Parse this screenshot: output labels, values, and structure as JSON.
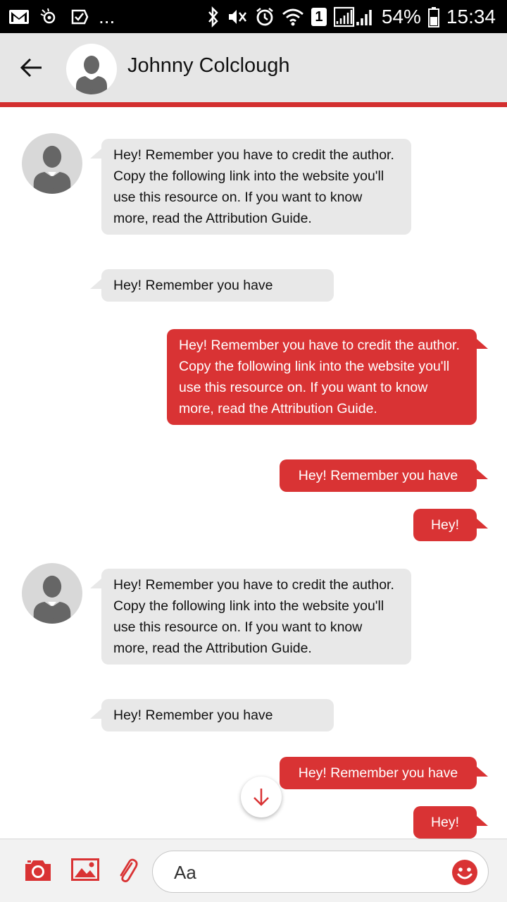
{
  "status_bar": {
    "battery": "54%",
    "time": "15:34",
    "sim_badge": "1",
    "more": "..."
  },
  "header": {
    "contact_name": "Johnny Colclough"
  },
  "messages": [
    {
      "direction": "in",
      "text": "Hey! Remember you have to credit the author. Copy the following link into the website you'll use this resource on. If you want to know more, read the Attribution Guide."
    },
    {
      "direction": "in",
      "text": "Hey! Remember you have"
    },
    {
      "direction": "out",
      "text": "Hey! Remember you have to credit the author. Copy the following link into the website you'll use this resource on. If you want to know more, read the Attribution Guide."
    },
    {
      "direction": "out",
      "text": "Hey! Remember you have"
    },
    {
      "direction": "out",
      "text": "Hey!"
    },
    {
      "direction": "in",
      "text": "Hey! Remember you have to credit the author. Copy the following link into the website you'll use this resource on. If you want to know more, read the Attribution Guide."
    },
    {
      "direction": "in",
      "text": "Hey! Remember you have"
    },
    {
      "direction": "out",
      "text": "Hey! Remember you have"
    },
    {
      "direction": "out",
      "text": "Hey!"
    }
  ],
  "composer": {
    "placeholder": "Aa"
  },
  "icons": {
    "back": "arrow-left-icon",
    "camera": "camera-icon",
    "gallery": "image-icon",
    "attach": "paperclip-icon",
    "emoji": "smiley-icon",
    "scroll_down": "arrow-down-icon"
  },
  "colors": {
    "accent": "#d93334",
    "incoming_bubble": "#e8e8e8",
    "header_bg": "#e6e6e6"
  }
}
